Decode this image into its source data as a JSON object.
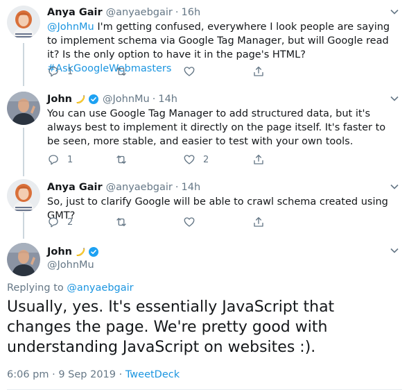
{
  "thread": [
    {
      "avatar": "anya-avatar",
      "name": "Anya Gair",
      "handle": "@anyaebgair",
      "sep": "·",
      "time": "16h",
      "mention": "@JohnMu",
      "text": " I'm getting confused, everywhere I look people are saying to implement schema via Google Tag Manager, but will Google read it? Is the only option to have it in the page's HTML?",
      "hashtag": "#AskGoogleWebmasters",
      "reply_count": "1",
      "retweet_count": "",
      "like_count": ""
    },
    {
      "avatar": "john-avatar",
      "name": "John",
      "emoji": "banana-icon",
      "verified": true,
      "handle": "@JohnMu",
      "sep": "·",
      "time": "14h",
      "text": "You can use Google Tag Manager to add structured data, but it's always best to implement it directly on the page itself. It's faster to be seen, more stable, and easier to test with your own tools.",
      "reply_count": "1",
      "retweet_count": "",
      "like_count": "2"
    },
    {
      "avatar": "anya-avatar",
      "name": "Anya Gair",
      "handle": "@anyaebgair",
      "sep": "·",
      "time": "14h",
      "text": "So, just to clarify Google will be able to crawl schema created using GMT?",
      "reply_count": "2",
      "retweet_count": "",
      "like_count": ""
    }
  ],
  "main_tweet": {
    "name": "John",
    "emoji": "banana-icon",
    "verified": true,
    "handle": "@JohnMu",
    "replying_prefix": "Replying to ",
    "replying_to": "@anyaebgair",
    "text": "Usually, yes. It's essentially JavaScript that changes the page. We're pretty good with understanding JavaScript on websites :).",
    "timestamp": "6:06 pm · 9 Sep 2019",
    "meta_sep": " · ",
    "source": "TweetDeck"
  },
  "colors": {
    "link": "#1b95e0",
    "secondary": "#657786",
    "text": "#14171a",
    "thread_line": "#ccd6dd",
    "verified": "#1da1f2"
  },
  "icons": {
    "reply": "reply-icon",
    "retweet": "retweet-icon",
    "like": "heart-icon",
    "share": "share-icon",
    "more": "chevron-down-icon",
    "verified": "verified-badge-icon"
  }
}
